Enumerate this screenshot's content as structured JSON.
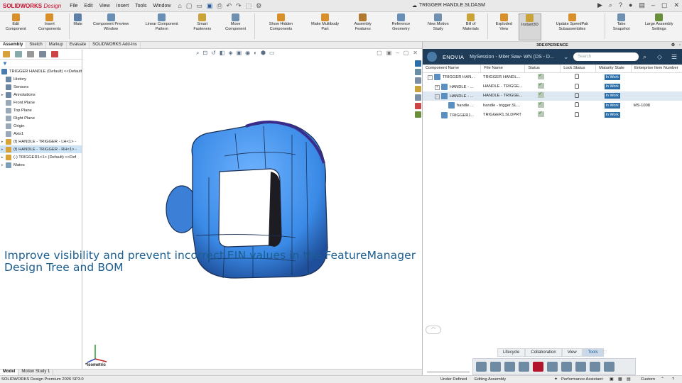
{
  "app": {
    "logo": "SOLIDWORKS",
    "logo_suffix": "Design",
    "document_title": "TRIGGER HANDLE.SLDASM",
    "menus": [
      "File",
      "Edit",
      "View",
      "Insert",
      "Tools",
      "Window"
    ]
  },
  "commands": [
    {
      "label": "Edit Component",
      "icon": "edit-component-icon",
      "color": "#d8902a"
    },
    {
      "label": "Insert Components",
      "icon": "insert-components-icon",
      "color": "#d8902a"
    },
    {
      "label": "Mate",
      "icon": "mate-icon",
      "color": "#5b7fa6"
    },
    {
      "label": "Component Preview Window",
      "icon": "component-preview-icon",
      "color": "#6a8fb5"
    },
    {
      "label": "Linear Component Pattern",
      "icon": "linear-pattern-icon",
      "color": "#6a8fb5"
    },
    {
      "label": "Smart Fasteners",
      "icon": "smart-fasteners-icon",
      "color": "#c9a23a"
    },
    {
      "label": "Move Component",
      "icon": "move-component-icon",
      "color": "#7090b0"
    },
    {
      "label": "Show Hidden Components",
      "icon": "show-hidden-icon",
      "color": "#d8902a"
    },
    {
      "label": "Make Multibody Part",
      "icon": "multibody-icon",
      "color": "#d8902a"
    },
    {
      "label": "Assembly Features",
      "icon": "assembly-features-icon",
      "color": "#b07a30"
    },
    {
      "label": "Reference Geometry",
      "icon": "reference-geometry-icon",
      "color": "#6a8fb5"
    },
    {
      "label": "New Motion Study",
      "icon": "motion-study-icon",
      "color": "#7090b0"
    },
    {
      "label": "Bill of Materials",
      "icon": "bom-icon",
      "color": "#c9a23a"
    },
    {
      "label": "Exploded View",
      "icon": "exploded-view-icon",
      "color": "#d8902a"
    },
    {
      "label": "Instant3D",
      "icon": "instant3d-icon",
      "color": "#c9a23a",
      "active": true
    },
    {
      "label": "Update SpeedPak Subassemblies",
      "icon": "speedpak-icon",
      "color": "#d8902a"
    },
    {
      "label": "Take Snapshot",
      "icon": "snapshot-icon",
      "color": "#7090b0"
    },
    {
      "label": "Large Assembly Settings",
      "icon": "large-assembly-icon",
      "color": "#6a8f3a"
    }
  ],
  "cmd_tabs": [
    "Assembly",
    "Sketch",
    "Markup",
    "Evaluate",
    "SOLIDWORKS Add-Ins"
  ],
  "tree": [
    {
      "label": "TRIGGER HANDLE (Default) <<Default",
      "twisty": "",
      "color": "#4a7ab0"
    },
    {
      "label": "History",
      "twisty": "",
      "color": "#6b87a3"
    },
    {
      "label": "Sensors",
      "twisty": "",
      "color": "#6b87a3"
    },
    {
      "label": "Annotations",
      "twisty": "▸",
      "color": "#6b87a3"
    },
    {
      "label": "Front Plane",
      "twisty": "",
      "color": "#9aa9b8"
    },
    {
      "label": "Top Plane",
      "twisty": "",
      "color": "#9aa9b8"
    },
    {
      "label": "Right Plane",
      "twisty": "",
      "color": "#9aa9b8"
    },
    {
      "label": "Origin",
      "twisty": "",
      "color": "#9aa9b8"
    },
    {
      "label": "Axis1",
      "twisty": "",
      "color": "#9aa9b8"
    },
    {
      "label": "(f) HANDLE - TRIGGER - LH<1> -",
      "twisty": "▸",
      "color": "#d8a23a"
    },
    {
      "label": "(f) HANDLE - TRIGGER - RH<1> -",
      "twisty": "▸",
      "color": "#d8a23a",
      "selected": true
    },
    {
      "label": "(-) TRIGGER1<1> (Default) <<Def",
      "twisty": "▸",
      "color": "#d8a23a"
    },
    {
      "label": "Mates",
      "twisty": "▸",
      "color": "#7d9db8"
    }
  ],
  "caption": "Improve visibility and prevent incorrect EIN values in the FeatureManager Design Tree and BOM",
  "view_name": "*Isometric",
  "model_tabs": [
    "Model",
    "Motion Study 1"
  ],
  "status": {
    "product": "SOLIDWORKS Design Premium 2026 SP3.0",
    "state": "Under Defined",
    "mode": "Editing Assembly",
    "perf": "Performance Assistant:",
    "units": "Custom"
  },
  "taskpane": {
    "header": "3DEXPERIENCE",
    "brand": "ENOVIA",
    "session": "MySession - Miter Saw- WN (DS - D...",
    "search_placeholder": "Search",
    "columns": [
      "Component Name",
      "File Name",
      "Status",
      "Lock Status",
      "Maturity State",
      "Enterprise Item Number"
    ],
    "rows": [
      {
        "indent": 0,
        "expander": "−",
        "name": "TRIGGER HAN...",
        "file": "TRIGGER HANDL...",
        "state": "In Work",
        "ein": "",
        "highlight": false
      },
      {
        "indent": 1,
        "expander": "+",
        "name": "HANDLE - ...",
        "file": "HANDLE - TRIGGE...",
        "state": "In Work",
        "ein": "",
        "highlight": false
      },
      {
        "indent": 1,
        "expander": "−",
        "name": "HANDLE - ...",
        "file": "HANDLE - TRIGGE...",
        "state": "In Work",
        "ein": "",
        "highlight": true
      },
      {
        "indent": 2,
        "expander": "",
        "name": "handle ...",
        "file": "handle - trigger.SL...",
        "state": "In Work",
        "ein": "MS-1008",
        "highlight": false
      },
      {
        "indent": 1,
        "expander": "",
        "name": "TRIGGER1...",
        "file": "TRIGGER1.SLDPRT",
        "state": "In Work",
        "ein": "",
        "highlight": false
      }
    ],
    "bottom_tabs": [
      "Lifecycle",
      "Collaboration",
      "View",
      "Tools"
    ],
    "active_bottom_tab": "Tools"
  }
}
